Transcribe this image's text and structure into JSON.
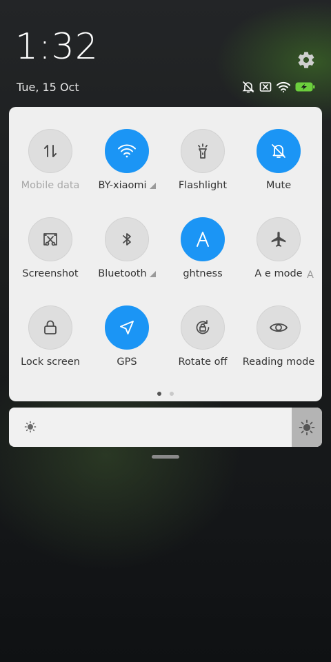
{
  "status": {
    "time": "1:32",
    "date": "Tue, 15 Oct",
    "icons": [
      "alarm-off-icon",
      "sim-off-icon",
      "wifi-icon",
      "battery-charging-icon"
    ]
  },
  "colors": {
    "active_tile": "#1b95f5",
    "inactive_tile": "#dedede",
    "panel_bg": "#efefef",
    "battery": "#6ccf3d"
  },
  "quick_settings": {
    "tiles": [
      {
        "label": "Mobile data",
        "icon": "mobile-data-icon",
        "active": false,
        "disabled": true
      },
      {
        "label": "BY-xiaomi",
        "icon": "wifi-icon",
        "active": true,
        "has_arrow": true
      },
      {
        "label": "Flashlight",
        "icon": "flashlight-icon",
        "active": false
      },
      {
        "label": "Mute",
        "icon": "bell-off-icon",
        "active": true
      },
      {
        "label": "Screenshot",
        "icon": "screenshot-icon",
        "active": false
      },
      {
        "label": "Bluetooth",
        "icon": "bluetooth-icon",
        "active": false,
        "has_arrow": true
      },
      {
        "label": "ghtness",
        "icon": "auto-brightness-icon",
        "active": true
      },
      {
        "label": "A  e mode",
        "icon": "airplane-icon",
        "active": false
      },
      {
        "label": "Lock screen",
        "icon": "lock-icon",
        "active": false
      },
      {
        "label": "GPS",
        "icon": "gps-icon",
        "active": true
      },
      {
        "label": "Rotate off",
        "icon": "rotate-lock-icon",
        "active": false
      },
      {
        "label": "Reading mode",
        "icon": "eye-icon",
        "active": false
      }
    ],
    "page_indicator": {
      "current": 1,
      "total": 2
    },
    "overflow_letter": "A"
  },
  "brightness": {
    "level": 0.9,
    "low_icon": "brightness-low-icon",
    "high_icon": "brightness-high-icon"
  }
}
